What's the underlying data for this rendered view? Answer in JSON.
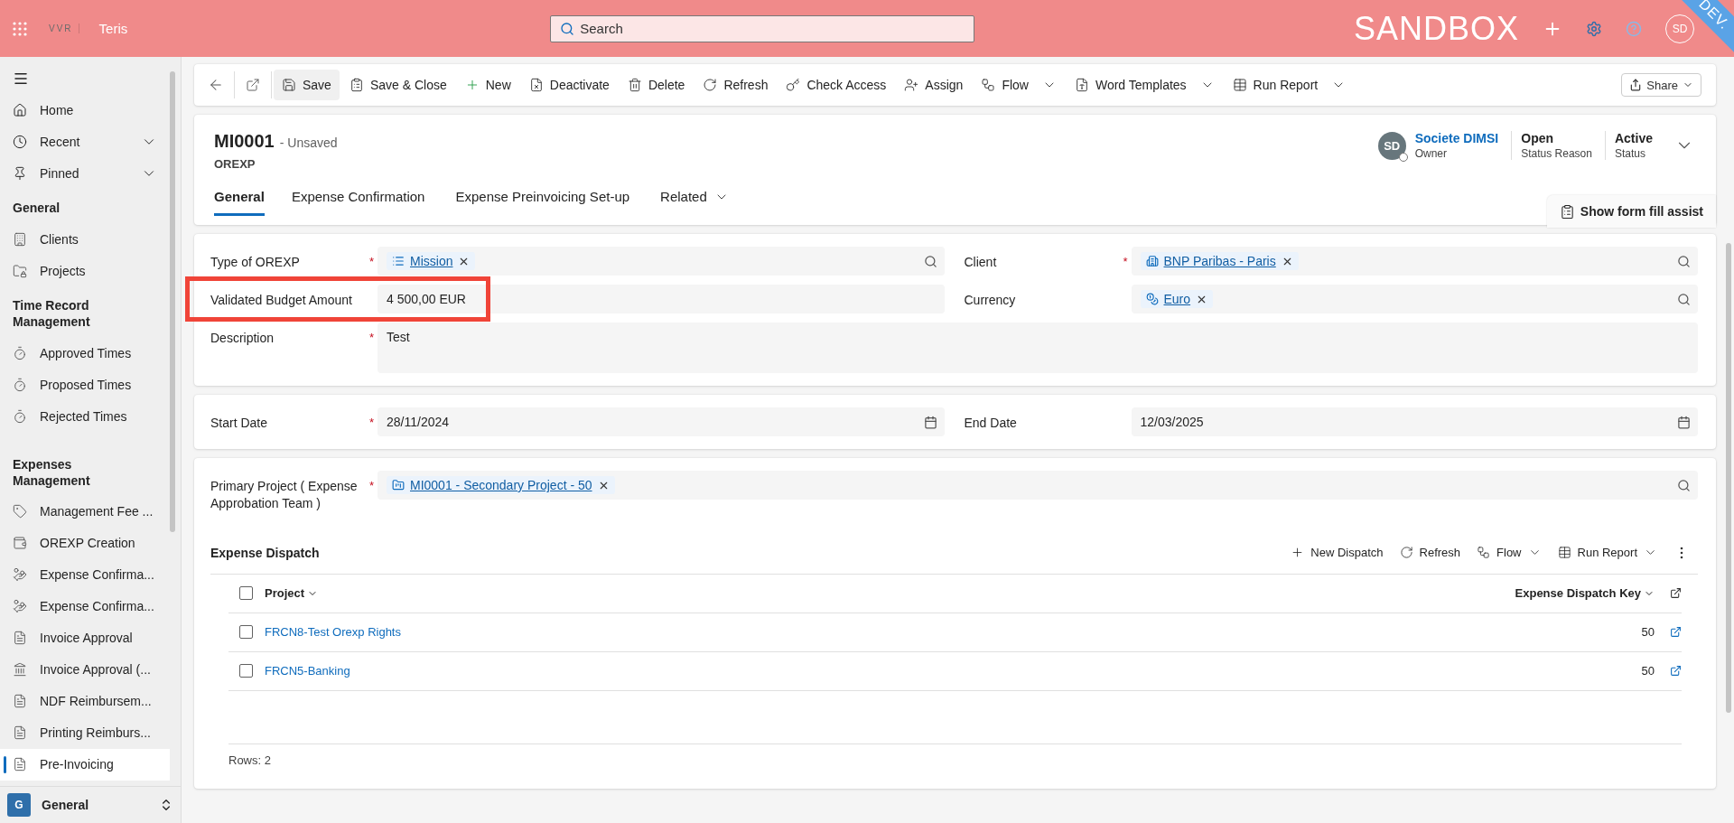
{
  "top_bar": {
    "logo": "VVR",
    "app_name": "Teris",
    "search": {
      "placeholder": "Search"
    },
    "environment": "SANDBOX",
    "avatar": "SD",
    "ribbon": "DEV."
  },
  "sidebar": {
    "top_items": [
      {
        "label": "Home",
        "expandable": false
      },
      {
        "label": "Recent",
        "expandable": true
      },
      {
        "label": "Pinned",
        "expandable": true
      }
    ],
    "groups": [
      {
        "title": "General",
        "items": [
          {
            "label": "Clients",
            "selected": false
          },
          {
            "label": "Projects",
            "selected": false
          }
        ]
      },
      {
        "title": "Time Record Management",
        "items": [
          {
            "label": "Approved Times",
            "selected": false
          },
          {
            "label": "Proposed Times",
            "selected": false
          },
          {
            "label": "Rejected Times",
            "selected": false
          }
        ]
      },
      {
        "title": "Expenses Management",
        "items": [
          {
            "label": "Management Fee ...",
            "selected": false
          },
          {
            "label": "OREXP Creation",
            "selected": false
          },
          {
            "label": "Expense Confirma...",
            "selected": false
          },
          {
            "label": "Expense Confirma...",
            "selected": false
          },
          {
            "label": "Invoice Approval",
            "selected": false
          },
          {
            "label": "Invoice Approval (...",
            "selected": false
          },
          {
            "label": "NDF Reimbursem...",
            "selected": false
          },
          {
            "label": "Printing Reimburs...",
            "selected": false
          },
          {
            "label": "Pre-Invoicing",
            "selected": true
          }
        ]
      }
    ],
    "area_switcher": {
      "badge": "G",
      "label": "General"
    }
  },
  "command_bar": {
    "commands": [
      {
        "label": "Save",
        "has_menu": false,
        "selected": true
      },
      {
        "label": "Save & Close",
        "has_menu": false,
        "selected": false
      },
      {
        "label": "New",
        "has_menu": false,
        "selected": false
      },
      {
        "label": "Deactivate",
        "has_menu": false,
        "selected": false
      },
      {
        "label": "Delete",
        "has_menu": false,
        "selected": false
      },
      {
        "label": "Refresh",
        "has_menu": false,
        "selected": false
      },
      {
        "label": "Check Access",
        "has_menu": false,
        "selected": false
      },
      {
        "label": "Assign",
        "has_menu": false,
        "selected": false
      },
      {
        "label": "Flow",
        "has_menu": true,
        "selected": false
      },
      {
        "label": "Word Templates",
        "has_menu": true,
        "selected": false
      },
      {
        "label": "Run Report",
        "has_menu": true,
        "selected": false
      }
    ],
    "share": {
      "label": "Share",
      "has_menu": true
    }
  },
  "header": {
    "title": "MI0001",
    "save_state": "- Unsaved",
    "entity": "OREXP",
    "owner": {
      "initials": "SD",
      "name": "Societe DIMSI",
      "role": "Owner"
    },
    "facts": [
      {
        "value": "Open",
        "label": "Status Reason"
      },
      {
        "value": "Active",
        "label": "Status"
      }
    ],
    "tabs": [
      {
        "label": "General",
        "selected": true,
        "has_menu": false
      },
      {
        "label": "Expense Confirmation",
        "selected": false,
        "has_menu": false
      },
      {
        "label": "Expense Preinvoicing Set-up",
        "selected": false,
        "has_menu": false
      },
      {
        "label": "Related",
        "selected": false,
        "has_menu": true
      }
    ],
    "assist_button": "Show form fill assist"
  },
  "required_marker": "*",
  "sections": [
    {
      "rows": [
        [
          {
            "kind": "lookup",
            "label": "Type of OREXP",
            "required": true,
            "highlighted": false,
            "value": "Mission"
          },
          {
            "kind": "lookup",
            "label": "Client",
            "required": true,
            "highlighted": false,
            "value": "BNP Paribas - Paris"
          }
        ],
        [
          {
            "kind": "text",
            "label": "Validated Budget Amount",
            "required": false,
            "highlighted": true,
            "value": "4 500,00 EUR"
          },
          {
            "kind": "lookup",
            "label": "Currency",
            "required": false,
            "highlighted": false,
            "value": "Euro"
          }
        ],
        [
          {
            "kind": "textarea",
            "label": "Description",
            "required": true,
            "highlighted": false,
            "value": "Test"
          }
        ]
      ]
    },
    {
      "rows": [
        [
          {
            "kind": "date",
            "label": "Start Date",
            "required": true,
            "highlighted": false,
            "value": "28/11/2024"
          },
          {
            "kind": "date",
            "label": "End Date",
            "required": false,
            "highlighted": false,
            "value": "12/03/2025"
          }
        ]
      ]
    },
    {
      "rows": [
        [
          {
            "kind": "lookup",
            "label": "Primary Project ( Expense Approbation Team )",
            "required": true,
            "highlighted": false,
            "value": "MI0001 - Secondary Project - 50"
          }
        ]
      ],
      "subgrid": {
        "title": "Expense Dispatch",
        "commands": [
          {
            "label": "New Dispatch",
            "has_menu": false
          },
          {
            "label": "Refresh",
            "has_menu": false
          },
          {
            "label": "Flow",
            "has_menu": true
          },
          {
            "label": "Run Report",
            "has_menu": true
          }
        ],
        "select_all": {
          "checked": false
        },
        "columns": [
          "Project",
          "Expense Dispatch Key"
        ],
        "rows": [
          {
            "checked": false,
            "project": "FRCN8-Test Orexp Rights",
            "key": "50"
          },
          {
            "checked": false,
            "project": "FRCN5-Banking",
            "key": "50"
          }
        ],
        "footer": "Rows: 2"
      }
    }
  ]
}
